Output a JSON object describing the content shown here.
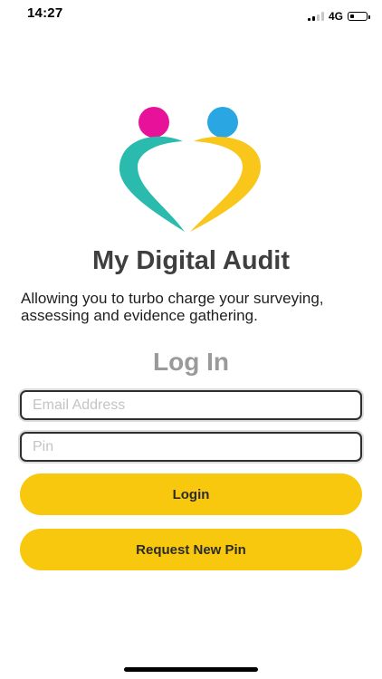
{
  "status_bar": {
    "time": "14:27",
    "network": "4G",
    "signal_bars_active": 2,
    "signal_bars_total": 4,
    "battery_level": 0.3
  },
  "logo": {
    "icon": "heart-people-logo-icon",
    "colors": {
      "left_head": "#e8119a",
      "right_head": "#2aa7e3",
      "left_body": "#2bbbae",
      "right_body": "#f9c71b"
    }
  },
  "app": {
    "title": "My Digital Audit",
    "tagline": "Allowing you to turbo charge your surveying, assessing and evidence gathering."
  },
  "login": {
    "heading": "Log In",
    "email_placeholder": "Email Address",
    "email_value": "",
    "pin_placeholder": "Pin",
    "pin_value": "",
    "login_label": "Login",
    "request_pin_label": "Request New Pin"
  },
  "colors": {
    "accent": "#f8c80f",
    "heading_gray": "#9a9a9a",
    "title_dark": "#3f3f3f"
  }
}
